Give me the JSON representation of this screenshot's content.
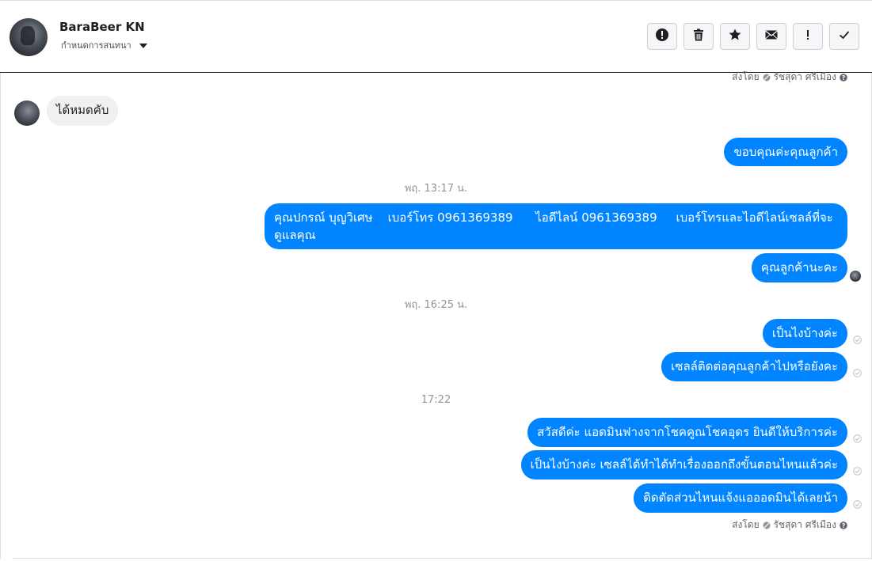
{
  "header": {
    "contact_name": "BaraBeer KN",
    "assign_label": "กำหนดการสนทนา",
    "toolbar": [
      {
        "name": "report-spam-button",
        "icon": "alert-circle-icon"
      },
      {
        "name": "delete-button",
        "icon": "trash-icon"
      },
      {
        "name": "star-button",
        "icon": "star-icon"
      },
      {
        "name": "mark-unread-button",
        "icon": "envelope-icon"
      },
      {
        "name": "follow-up-button",
        "icon": "exclamation-icon"
      },
      {
        "name": "mark-done-button",
        "icon": "check-icon"
      }
    ]
  },
  "conversation": {
    "sent_by_top": {
      "prefix": "ส่งโดย",
      "agent": "รัชสุดา ศรีเมือง"
    },
    "incoming_message": "ได้หมดคับ",
    "msg_thanks": "ขอบคุณค่ะคุณลูกค้า",
    "time_1": "พฤ. 13:17 น.",
    "msg_contact_line1": "คุณปกรณ์ บุญวิเศษ    เบอร์โทร 0961369389      ไอดีไลน์ 0961369389     เบอร์โทรและไอดีไลน์เซลล์ที่จะ",
    "msg_contact_line2": "ดูแลคุณ",
    "msg_customer": "คุณลูกค้านะคะ",
    "time_2": "พฤ. 16:25 น.",
    "msg_how": "เป็นไงบ้างค่ะ",
    "msg_sales_contact": "เซลล์ติดต่อคุณลูกค้าไปหรือยังคะ",
    "time_3": "17:22",
    "msg_greeting": "สวัสดีค่ะ แอดมินฟางจากโชคคูณโชคอุดร ยินดีให้บริการค่ะ",
    "msg_progress": "เป็นไงบ้างค่ะ เซลล์ได้ทำได้ทำเรื่องออกถึงขั้นตอนไหนแล้วค่ะ",
    "msg_tell": "ติดตัดส่วนไหนแจ้งแอออดมินได้เลยน้า",
    "sent_by_bottom": {
      "prefix": "ส่งโดย",
      "agent": "รัชสุดา ศรีเมือง"
    }
  },
  "colors": {
    "outgoing_bubble": "#0084ff",
    "incoming_bubble": "#f1f0f0",
    "meta_text": "#90949c"
  }
}
